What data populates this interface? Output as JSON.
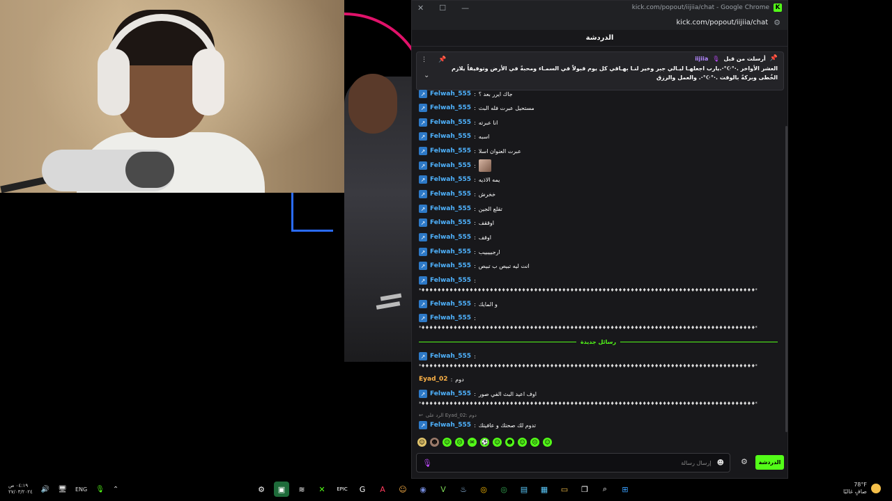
{
  "browser": {
    "title": "kick.com/popout/iijiia/chat - Google Chrome",
    "url": "kick.com/popout/iijiia/chat",
    "accent": "#53fc18"
  },
  "chat": {
    "header": "الدردشة",
    "pinned": {
      "label": "أرسلت من قبل",
      "user": "iijiia",
      "text": "العشر الأواخر .·°☪°·.يارب اجعلهـا ليـالي جبر وخير لنـا بهـاقي كل يوم قبولاً في السمـاء ومحبةً في الأرض وتوفيقاً يلازم الخُطى وبركةً بالوقت .·°☪°·. والعمل والرزق"
    },
    "messages": [
      {
        "user": "Felwah_555",
        "text": "جاك ايرر بعد ؟"
      },
      {
        "user": "Felwah_555",
        "text": "مستحيل عبرت فله البث"
      },
      {
        "user": "Felwah_555",
        "text": "انا عبرته"
      },
      {
        "user": "Felwah_555",
        "text": "اسبه"
      },
      {
        "user": "Felwah_555",
        "text": "عبرت العنوان اسلا"
      },
      {
        "user": "Felwah_555",
        "text": ""
      },
      {
        "user": "Felwah_555",
        "text": "يمه الاذيه"
      },
      {
        "user": "Felwah_555",
        "text": "خخرش"
      },
      {
        "user": "Felwah_555",
        "text": "تقلع الجين"
      },
      {
        "user": "Felwah_555",
        "text": "اوققف"
      },
      {
        "user": "Felwah_555",
        "text": "اوقف"
      },
      {
        "user": "Felwah_555",
        "text": "ارجيييييب"
      },
      {
        "user": "Felwah_555",
        "text": "انت ليه تبيص ب تبيص"
      },
      {
        "user": "Felwah_555",
        "text": ""
      },
      {
        "user": "Felwah_555",
        "text": "و المايك"
      },
      {
        "user": "Felwah_555",
        "text": ""
      },
      {
        "user": "Felwah_555",
        "text": ""
      },
      {
        "user": "Eyad_02",
        "text": "دوم"
      },
      {
        "user": "Felwah_555",
        "text": "اوف اعيد البث الفي صور"
      },
      {
        "user": "Felwah_555",
        "text": "تدوم لك صحتك و عافيتك"
      }
    ],
    "stars": "*♦♦♦♦♦♦♦♦♦♦♦♦♦♦♦♦♦♦♦♦♦♦♦♦♦♦♦♦♦♦♦♦♦♦♦♦♦♦♦♦♦♦♦♦♦♦♦♦♦♦♦♦♦♦♦♦♦♦♦♦♦♦♦♦♦♦♦♦♦♦♦♦♦♦♦♦♦♦♦♦♦♦♦*",
    "new_messages": "رسائل جديدة",
    "reply_hint": "الرد على Eyad_02: دوم",
    "input_placeholder": "إرسال رسالة",
    "send_button": "الدردشة"
  },
  "taskbar": {
    "time": "٠٤:١٩ ص",
    "date": "٢٧/٠٣/٢٠٢٤",
    "lang": "ENG",
    "weather_temp": "78°F",
    "weather_desc": "صافٍ غالبًا"
  }
}
